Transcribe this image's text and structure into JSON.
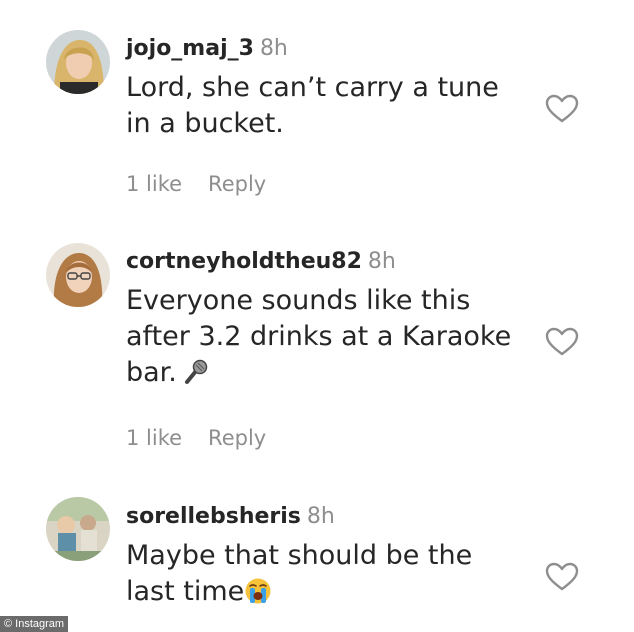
{
  "comments": [
    {
      "username": "jojo_maj_3",
      "time": "8h",
      "text_lines": [
        "Lord, she can’t carry a tune",
        "in a bucket."
      ],
      "likes": "1 like",
      "reply": "Reply",
      "avatar": "blonde-woman-avatar"
    },
    {
      "username": "cortneyholdtheu82",
      "time": "8h",
      "text_lines": [
        "Everyone sounds like this",
        "after 3.2 drinks at a Karaoke",
        "bar."
      ],
      "likes": "1 like",
      "reply": "Reply",
      "avatar": "woman-glasses-avatar",
      "emoji": "microphone-icon"
    },
    {
      "username": "sorellebsheris",
      "time": "8h",
      "text_lines": [
        "Maybe that should be the",
        "last time"
      ],
      "avatar": "outdoor-photo-avatar",
      "emoji": "loudly-crying-face-icon"
    }
  ],
  "watermark": "© Instagram",
  "colors": {
    "text": "#262626",
    "secondary": "#8e8e8e",
    "heart_stroke": "#8e8e8e"
  }
}
